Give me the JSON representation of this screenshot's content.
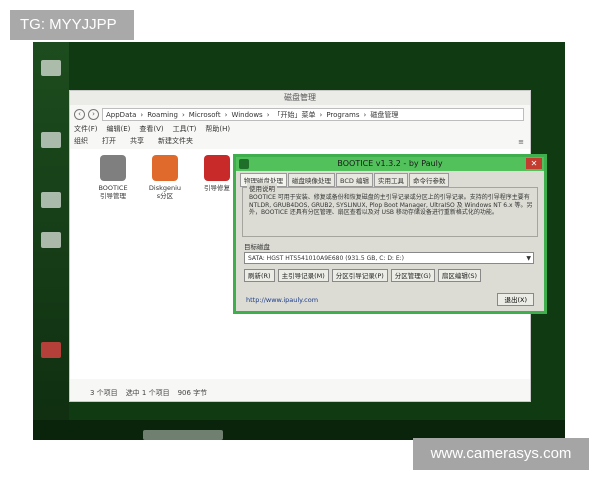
{
  "tag_banner": "TG: MYYJJPP",
  "watermark": "www.camerasys.com",
  "explorer": {
    "title": "磁盘管理",
    "address_segments": [
      "AppData",
      "Roaming",
      "Microsoft",
      "Windows",
      "「开始」菜单",
      "Programs",
      "磁盘管理"
    ],
    "menu": [
      "文件(F)",
      "编辑(E)",
      "查看(V)",
      "工具(T)",
      "帮助(H)"
    ],
    "toolbar": [
      "组织",
      "打开",
      "共享",
      "新建文件夹"
    ],
    "view_icon": "≡",
    "files": [
      {
        "label": "BOOTICE\n引导管理",
        "icon": "bootice-icon",
        "color": "#7f7f7f"
      },
      {
        "label": "Diskgeniu\ns分区",
        "icon": "diskgenius-icon",
        "color": "#e06a2c"
      },
      {
        "label": "引导修复",
        "icon": "repair-icon",
        "color": "#c82a2a"
      }
    ],
    "status": {
      "count": "3 个项目",
      "selected": "选中 1 个项目",
      "size": "906 字节"
    }
  },
  "bootice": {
    "title": "BOOTICE v1.3.2 - by Pauly",
    "close": "✕",
    "tabs": [
      "物理磁盘处理",
      "磁盘映像处理",
      "BCD 编辑",
      "实用工具",
      "命令行参数"
    ],
    "group_label": "使用说明",
    "description": "BOOTICE 可用于安装、修复或备份和恢复磁盘的主引导记录或分区上的引导记录。支持的引导程序主要有 NTLDR, GRUB4DOS, GRUB2, SYSLINUX, Plop Boot Manager, UltraISO 及 Windows NT 6.x 等。另外，BOOTICE 还具有分区管理、扇区查看以及对 USB 移动存储设备进行重新格式化的功能。",
    "disk_label": "目标磁盘",
    "disk_value": "SATA: HGST HTS541010A9E680 (931.5 GB, C: D: E:)",
    "buttons": [
      "刷新(R)",
      "主引导记录(M)",
      "分区引导记录(P)",
      "分区管理(G)",
      "扇区编辑(S)"
    ],
    "link": "http://www.ipauly.com",
    "exit": "退出(X)"
  }
}
